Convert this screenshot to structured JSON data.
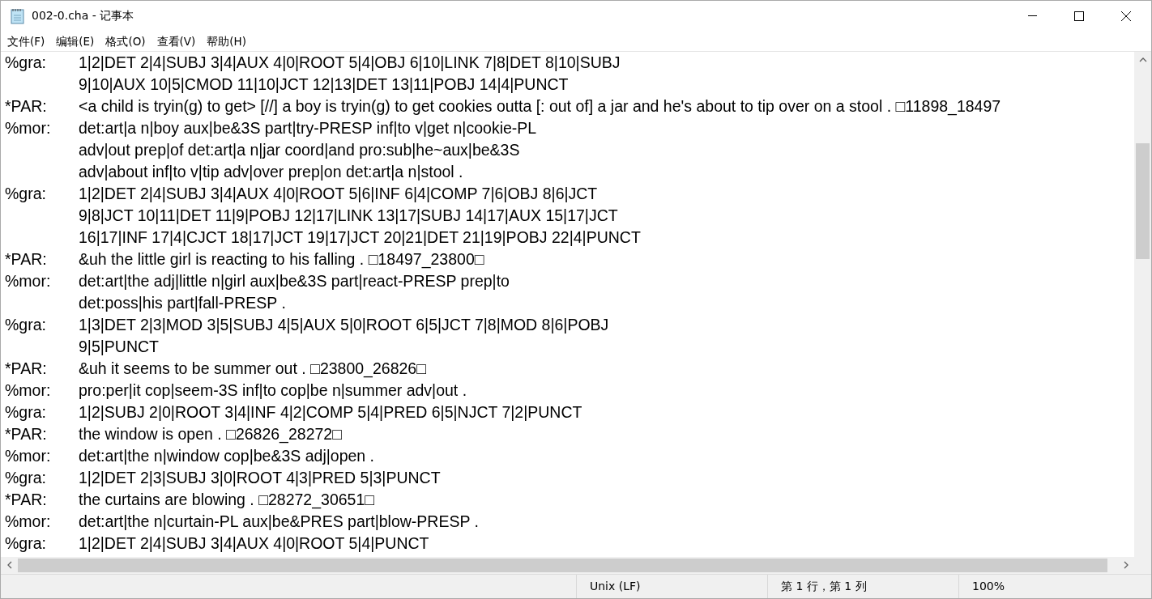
{
  "window": {
    "title": "002-0.cha - 记事本"
  },
  "menu": [
    "文件(F)",
    "编辑(E)",
    "格式(O)",
    "查看(V)",
    "帮助(H)"
  ],
  "entries": [
    {
      "tag": "%gra:",
      "lines": [
        "1|2|DET 2|4|SUBJ 3|4|AUX 4|0|ROOT 5|4|OBJ 6|10|LINK 7|8|DET 8|10|SUBJ",
        "9|10|AUX 10|5|CMOD 11|10|JCT 12|13|DET 13|11|POBJ 14|4|PUNCT"
      ]
    },
    {
      "tag": "*PAR:",
      "lines": [
        "<a child is tryin(g) to get> [//] a boy is tryin(g) to get cookies outta [: out of] a jar and he's about to tip over on a stool . □11898_18497"
      ]
    },
    {
      "tag": "%mor:",
      "lines": [
        "det:art|a n|boy aux|be&3S part|try-PRESP inf|to v|get n|cookie-PL",
        "adv|out prep|of det:art|a n|jar coord|and pro:sub|he~aux|be&3S",
        "adv|about inf|to v|tip adv|over prep|on det:art|a n|stool ."
      ]
    },
    {
      "tag": "%gra:",
      "lines": [
        "1|2|DET 2|4|SUBJ 3|4|AUX 4|0|ROOT 5|6|INF 6|4|COMP 7|6|OBJ 8|6|JCT",
        "9|8|JCT 10|11|DET 11|9|POBJ 12|17|LINK 13|17|SUBJ 14|17|AUX 15|17|JCT",
        "16|17|INF 17|4|CJCT 18|17|JCT 19|17|JCT 20|21|DET 21|19|POBJ 22|4|PUNCT"
      ]
    },
    {
      "tag": "*PAR:",
      "lines": [
        "&uh the little girl is reacting to his falling . □18497_23800□"
      ]
    },
    {
      "tag": "%mor:",
      "lines": [
        "det:art|the adj|little n|girl aux|be&3S part|react-PRESP prep|to",
        "det:poss|his part|fall-PRESP ."
      ]
    },
    {
      "tag": "%gra:",
      "lines": [
        "1|3|DET 2|3|MOD 3|5|SUBJ 4|5|AUX 5|0|ROOT 6|5|JCT 7|8|MOD 8|6|POBJ",
        "9|5|PUNCT"
      ]
    },
    {
      "tag": "*PAR:",
      "lines": [
        "&uh it seems to be summer out . □23800_26826□"
      ]
    },
    {
      "tag": "%mor:",
      "lines": [
        "pro:per|it cop|seem-3S inf|to cop|be n|summer adv|out ."
      ]
    },
    {
      "tag": "%gra:",
      "lines": [
        "1|2|SUBJ 2|0|ROOT 3|4|INF 4|2|COMP 5|4|PRED 6|5|NJCT 7|2|PUNCT"
      ]
    },
    {
      "tag": "*PAR:",
      "lines": [
        "the window is open . □26826_28272□"
      ]
    },
    {
      "tag": "%mor:",
      "lines": [
        "det:art|the n|window cop|be&3S adj|open ."
      ]
    },
    {
      "tag": "%gra:",
      "lines": [
        "1|2|DET 2|3|SUBJ 3|0|ROOT 4|3|PRED 5|3|PUNCT"
      ]
    },
    {
      "tag": "*PAR:",
      "lines": [
        "the curtains are blowing . □28272_30651□"
      ]
    },
    {
      "tag": "%mor:",
      "lines": [
        "det:art|the n|curtain-PL aux|be&PRES part|blow-PRESP ."
      ]
    },
    {
      "tag": "%gra:",
      "lines": [
        "1|2|DET 2|4|SUBJ 3|4|AUX 4|0|ROOT 5|4|PUNCT"
      ]
    }
  ],
  "status_bar": {
    "line_ending": "Unix (LF)",
    "position": "第 1 行，第 1 列",
    "zoom": "100%"
  }
}
